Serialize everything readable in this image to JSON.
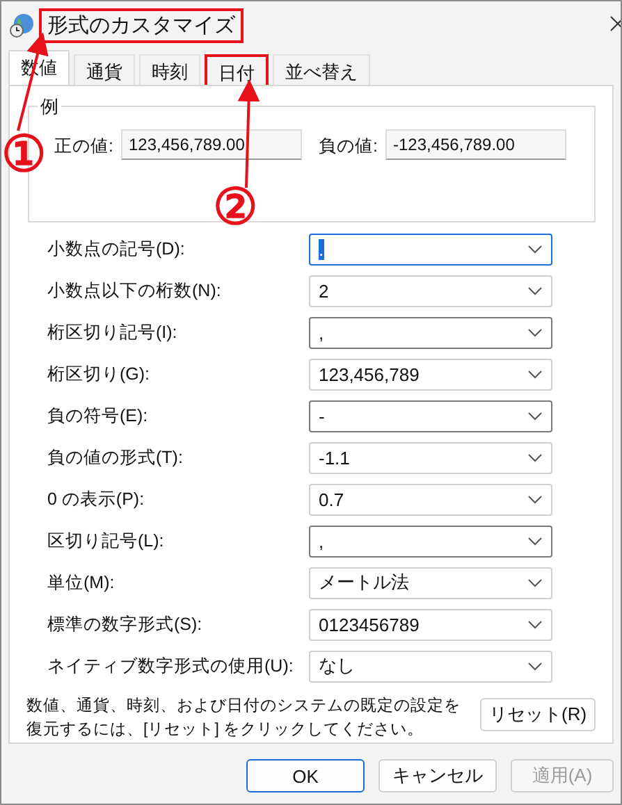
{
  "window": {
    "title": "形式のカスタマイズ",
    "title_highlighted": true
  },
  "tabs": [
    {
      "label": "数値",
      "selected": true,
      "highlighted": false
    },
    {
      "label": "通貨",
      "selected": false,
      "highlighted": false
    },
    {
      "label": "時刻",
      "selected": false,
      "highlighted": false
    },
    {
      "label": "日付",
      "selected": false,
      "highlighted": true
    },
    {
      "label": "並べ替え",
      "selected": false,
      "highlighted": false
    }
  ],
  "example": {
    "legend": "例",
    "positive_label": "正の値:",
    "positive_value": "123,456,789.00",
    "negative_label": "負の値:",
    "negative_value": "-123,456,789.00"
  },
  "settings": [
    {
      "label": "小数点の記号(D):",
      "value": ".",
      "editable": true,
      "focused": true
    },
    {
      "label": "小数点以下の桁数(N):",
      "value": "2",
      "editable": false,
      "focused": false
    },
    {
      "label": "桁区切り記号(I):",
      "value": ",",
      "editable": true,
      "focused": false
    },
    {
      "label": "桁区切り(G):",
      "value": "123,456,789",
      "editable": false,
      "focused": false
    },
    {
      "label": "負の符号(E):",
      "value": "-",
      "editable": true,
      "focused": false
    },
    {
      "label": "負の値の形式(T):",
      "value": "-1.1",
      "editable": false,
      "focused": false
    },
    {
      "label": "0 の表示(P):",
      "value": "0.7",
      "editable": false,
      "focused": false
    },
    {
      "label": "区切り記号(L):",
      "value": ",",
      "editable": true,
      "focused": false
    },
    {
      "label": "単位(M):",
      "value": "メートル法",
      "editable": false,
      "focused": false
    },
    {
      "label": "標準の数字形式(S):",
      "value": "0123456789",
      "editable": false,
      "focused": false
    },
    {
      "label": "ネイティブ数字形式の使用(U):",
      "value": "なし",
      "editable": false,
      "focused": false
    }
  ],
  "reset_note": "数値、通貨、時刻、および日付のシステムの既定の設定を復元するには、[リセット] をクリックしてください。",
  "reset_button": "リセット(R)",
  "buttons": [
    {
      "label": "OK",
      "default": true,
      "disabled": false
    },
    {
      "label": "キャンセル",
      "default": false,
      "disabled": false
    },
    {
      "label": "適用(A)",
      "default": false,
      "disabled": true
    }
  ],
  "callouts": [
    {
      "number": "①"
    },
    {
      "number": "②"
    }
  ]
}
